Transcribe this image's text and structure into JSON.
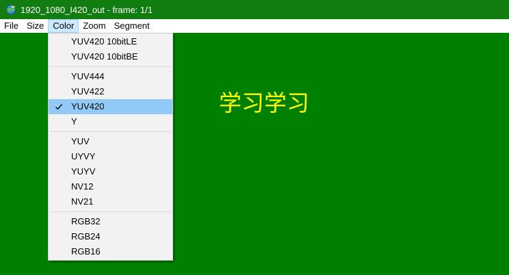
{
  "window": {
    "title": "1920_1080_I420_out - frame: 1/1"
  },
  "menubar": {
    "items": [
      "File",
      "Size",
      "Color",
      "Zoom",
      "Segment"
    ],
    "active": "Color"
  },
  "color_menu": {
    "groups": [
      {
        "items": [
          "YUV420 10bitLE",
          "YUV420 10bitBE"
        ]
      },
      {
        "items": [
          "YUV444",
          "YUV422",
          "YUV420",
          "Y"
        ]
      },
      {
        "items": [
          "YUV",
          "UYVY",
          "YUYV",
          "NV12",
          "NV21"
        ]
      },
      {
        "items": [
          "RGB32",
          "RGB24",
          "RGB16"
        ]
      }
    ],
    "checked": "YUV420"
  },
  "canvas": {
    "overlay_text": "学习学习"
  },
  "colors": {
    "titlebar": "#117d11",
    "canvas": "#008000",
    "overlay_text": "#ffff00",
    "menu_highlight": "#91c9f7"
  },
  "icons": {
    "app": "globe-icon",
    "check": "checkmark-icon"
  }
}
